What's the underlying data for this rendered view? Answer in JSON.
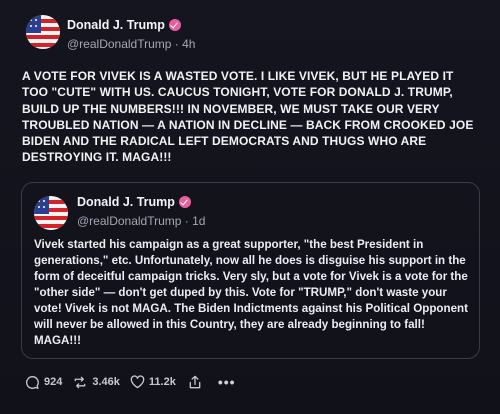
{
  "post": {
    "author_name": "Donald J. Trump",
    "handle_time": "@realDonaldTrump · 4h",
    "text": "A VOTE FOR VIVEK IS A WASTED VOTE. I LIKE VIVEK, BUT HE PLAYED IT TOO \"CUTE\" WITH US. CAUCUS TONIGHT, VOTE FOR DONALD J. TRUMP, BUILD UP THE NUMBERS!!! IN NOVEMBER, WE MUST TAKE OUR VERY TROUBLED NATION — A NATION IN DECLINE — BACK FROM CROOKED JOE BIDEN AND THE RADICAL LEFT DEMOCRATS AND THUGS WHO ARE DESTROYING IT. MAGA!!!"
  },
  "quote": {
    "author_name": "Donald J. Trump",
    "handle_time": "@realDonaldTrump · 1d",
    "text": "Vivek started his campaign as a great supporter, \"the best President in generations,\" etc. Unfortunately, now all he does is disguise his support in the form of deceitful campaign tricks. Very sly, but a vote for Vivek is a vote for the \"other side\" — don't get duped by this. Vote for \"TRUMP,\" don't waste your vote! Vivek is not MAGA. The Biden Indictments against his Political Opponent will never be allowed in this Country, they are already beginning to fall! MAGA!!!"
  },
  "actions": {
    "replies": "924",
    "retruths": "3.46k",
    "likes": "11.2k",
    "more": "•••"
  },
  "icons": {
    "verified": "verified-badge-icon",
    "reply": "reply-icon",
    "retruth": "retruth-icon",
    "like": "heart-icon",
    "share": "share-icon",
    "more": "more-icon"
  },
  "colors": {
    "background": "#101018",
    "badge": "#e85fa0",
    "text": "#f2f2f5",
    "muted": "#a6a6b4"
  }
}
